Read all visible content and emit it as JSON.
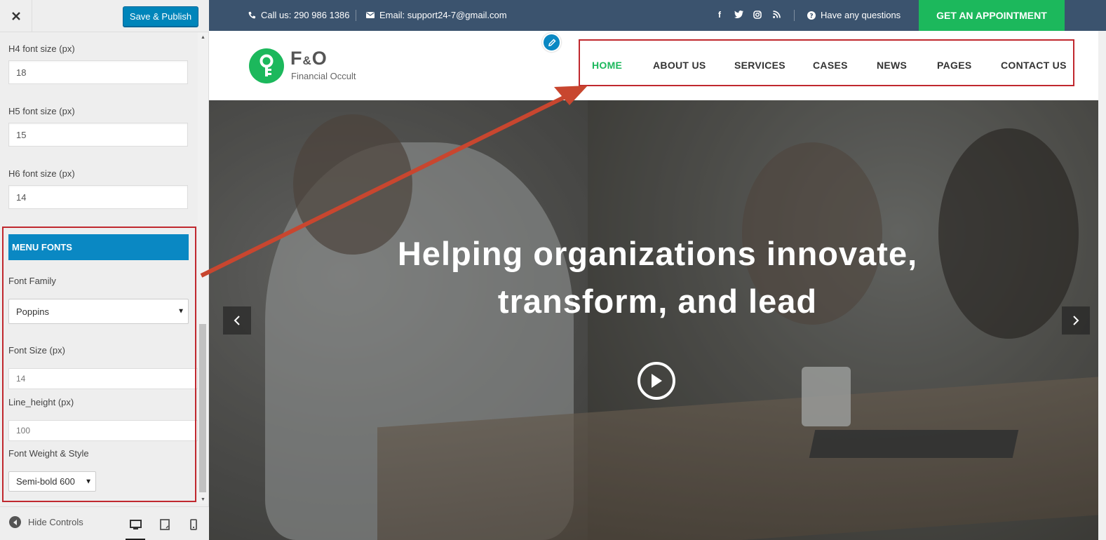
{
  "customizer": {
    "publish_label": "Save & Publish",
    "fields": {
      "h4_label": "H4 font size (px)",
      "h4_value": "18",
      "h5_label": "H5 font size (px)",
      "h5_value": "15",
      "h6_label": "H6 font size (px)",
      "h6_value": "14"
    },
    "menu_fonts": {
      "title": "MENU FONTS",
      "family_label": "Font Family",
      "family_value": "Poppins",
      "size_label": "Font Size (px)",
      "size_value": "14",
      "line_height_label": "Line_height (px)",
      "line_height_value": "100",
      "weight_label": "Font Weight & Style",
      "weight_value": "Semi-bold 600"
    },
    "footer": {
      "hide_controls": "Hide Controls"
    },
    "annotation_color": "#c0282e"
  },
  "site": {
    "topbar": {
      "call": "Call us: 290 986 1386",
      "email": "Email: support24-7@gmail.com",
      "social": [
        "facebook-icon",
        "twitter-icon",
        "instagram-icon",
        "rss-icon"
      ],
      "questions": "Have any questions",
      "appointment": "GET AN APPOINTMENT"
    },
    "logo": {
      "title_left": "F",
      "title_amp": "&",
      "title_right": "O",
      "subtitle": "Financial Occult"
    },
    "nav": [
      "HOME",
      "ABOUT US",
      "SERVICES",
      "CASES",
      "NEWS",
      "PAGES",
      "CONTACT US"
    ],
    "hero": {
      "line1": "Helping organizations innovate,",
      "line2": "transform, and lead"
    },
    "colors": {
      "brand_green": "#1cb85c",
      "topbar_bg": "#3b536e",
      "customizer_blue": "#0a88c3"
    }
  }
}
